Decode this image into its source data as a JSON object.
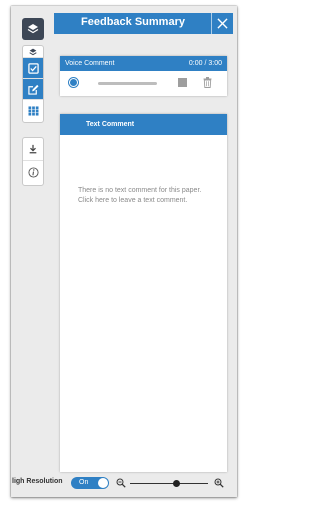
{
  "panel": {
    "title": "Feedback Summary"
  },
  "voice_comment": {
    "label": "Voice Comment",
    "time": "0:00 / 3:00"
  },
  "text_comment": {
    "label": "Text Comment",
    "empty_message": "There is no text comment for this paper. Click here to leave a text comment."
  },
  "footer": {
    "high_resolution_label": "ligh Resolution",
    "toggle_label": "On",
    "zoom_level": 0.6
  },
  "toolbar": {
    "tools": [
      "layers-icon",
      "layers-small-icon",
      "checkbox-icon",
      "edit-icon",
      "grid-icon",
      "download-icon",
      "info-icon"
    ]
  },
  "colors": {
    "accent": "#2f80c4",
    "dark_button": "#3d4756",
    "background": "#ebebeb"
  }
}
